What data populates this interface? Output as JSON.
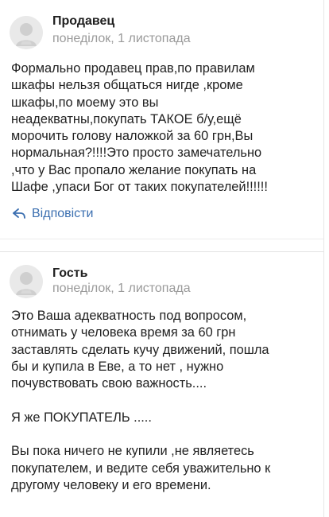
{
  "comments": [
    {
      "author": "Продавец",
      "date": "понеділок, 1 листопада",
      "text": "Формально продавец прав,по правилам\nшкафы нельзя общаться нигде ,кроме\nшкафы,по моему это вы\nнеадекватны,покупать ТАКОЕ б/у,ещё\nморочить голову наложкой за 60 грн,Вы\nнормальная?!!!!Это просто замечательно\n,что у Вас пропало желание покупать на\nШафе ,упаси Бог от таких покупателей!!!!!!",
      "reply_label": "Відповісти",
      "avatar_icon": "default-user-avatar-icon",
      "reply_icon": "reply-arrow-icon"
    },
    {
      "author": "Гость",
      "date": "понеділок, 1 листопада",
      "text": "Это Ваша адекватность под вопросом,\nотнимать у человека время за 60 грн\nзаставлять сделать кучу движений, пошла\nбы и купила в Еве, а то нет , нужно\nпочувствовать свою важность....\n\nЯ же ПОКУПАТЕЛЬ .....\n\nВы пока ничего не купили ,не являетесь\nпокупателем, и ведите себя уважительно к\nдругому человеку и его времени.",
      "avatar_icon": "default-user-avatar-icon"
    }
  ],
  "colors": {
    "link": "#3b6fb0",
    "date": "#9a9a9a",
    "text": "#222222",
    "avatar_bg": "#e9e9e9",
    "avatar_figure": "#c9c9c9"
  }
}
